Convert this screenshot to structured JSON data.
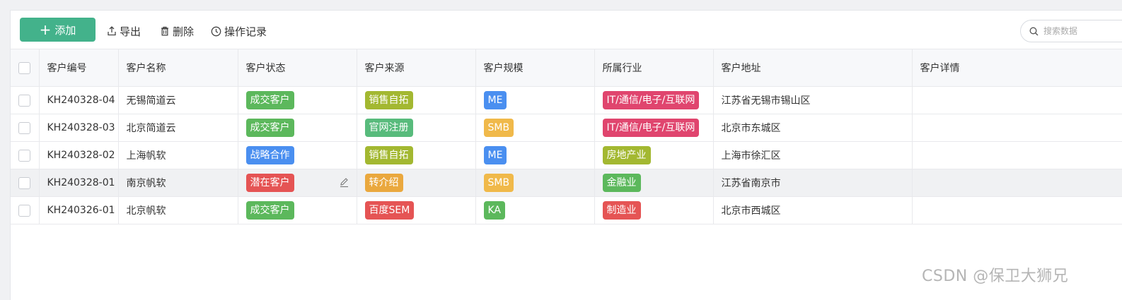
{
  "toolbar": {
    "add_label": "添加",
    "export_label": "导出",
    "delete_label": "删除",
    "log_label": "操作记录"
  },
  "search": {
    "placeholder": "搜索数据"
  },
  "table": {
    "columns": [
      "客户编号",
      "客户名称",
      "客户状态",
      "客户来源",
      "客户规模",
      "所属行业",
      "客户地址",
      "客户详情"
    ],
    "rows": [
      {
        "id": "KH240328-04",
        "name": "无锡简道云",
        "status": {
          "text": "成交客户",
          "color": "#5cb85c"
        },
        "source": {
          "text": "销售自拓",
          "color": "#a3b831"
        },
        "scale": {
          "text": "ME",
          "color": "#4a8ff0"
        },
        "industry": {
          "text": "IT/通信/电子/互联网",
          "color": "#e0456e"
        },
        "address": "江苏省无锡市锡山区",
        "detail": ""
      },
      {
        "id": "KH240328-03",
        "name": "北京简道云",
        "status": {
          "text": "成交客户",
          "color": "#5cb85c"
        },
        "source": {
          "text": "官网注册",
          "color": "#58bb7c"
        },
        "scale": {
          "text": "SMB",
          "color": "#f0b94a"
        },
        "industry": {
          "text": "IT/通信/电子/互联网",
          "color": "#e0456e"
        },
        "address": "北京市东城区",
        "detail": ""
      },
      {
        "id": "KH240328-02",
        "name": "上海帆软",
        "status": {
          "text": "战略合作",
          "color": "#4a8ff0"
        },
        "source": {
          "text": "销售自拓",
          "color": "#a3b831"
        },
        "scale": {
          "text": "ME",
          "color": "#4a8ff0"
        },
        "industry": {
          "text": "房地产业",
          "color": "#a3b831"
        },
        "address": "上海市徐汇区",
        "detail": ""
      },
      {
        "id": "KH240328-01",
        "name": "南京帆软",
        "status": {
          "text": "潜在客户",
          "color": "#e55454"
        },
        "source": {
          "text": "转介绍",
          "color": "#eaa83e"
        },
        "scale": {
          "text": "SMB",
          "color": "#f0b94a"
        },
        "industry": {
          "text": "金融业",
          "color": "#5cb85c"
        },
        "address": "江苏省南京市",
        "detail": ""
      },
      {
        "id": "KH240326-01",
        "name": "北京帆软",
        "status": {
          "text": "成交客户",
          "color": "#5cb85c"
        },
        "source": {
          "text": "百度SEM",
          "color": "#e55454"
        },
        "scale": {
          "text": "KA",
          "color": "#5cb85c"
        },
        "industry": {
          "text": "制造业",
          "color": "#e55454"
        },
        "address": "北京市西城区",
        "detail": ""
      }
    ]
  },
  "watermark": "CSDN @保卫大狮兄",
  "colors": {
    "primary": "#43b28b"
  }
}
